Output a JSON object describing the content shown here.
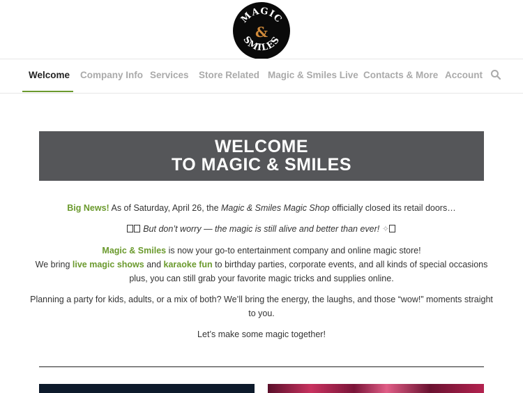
{
  "logo": {
    "line1": "MAGIC",
    "ampersand": "&",
    "line2": "SMILES"
  },
  "nav": {
    "items": [
      {
        "label": "Welcome",
        "active": true
      },
      {
        "label": "Company Info"
      },
      {
        "label": "Services"
      },
      {
        "label": "Store Related"
      },
      {
        "label": "Magic & Smiles Live"
      },
      {
        "label": "Contacts & More"
      },
      {
        "label": "Account"
      }
    ],
    "search_icon": "search-icon"
  },
  "banner": {
    "line1": "WELCOME",
    "line2": "TO MAGIC & SMILES"
  },
  "content": {
    "news_label": "Big News!",
    "news_text_a": " As of Saturday, April 26, the ",
    "news_shop": "Magic & Smiles Magic Shop",
    "news_text_b": " officially closed its retail doors…",
    "worry_text": " But don’t worry — the magic is still alive and better than ever! ",
    "brand": "Magic & Smiles",
    "brand_text": " is now your go-to entertainment company and online magic store!",
    "bring_a": "We bring ",
    "live_shows": "live magic shows",
    "bring_and": " and ",
    "karaoke": "karaoke fun",
    "bring_b": " to birthday parties, corporate events, and all kinds of special occasions",
    "bring_c": "plus, you can still grab your favorite magic tricks and supplies online.",
    "planning_a": "Planning a party for kids, adults, or a mix of both? We’ll bring the energy, the laughs, and those “wow!” moments straight",
    "planning_b": "to you.",
    "closing": "Let’s make some magic together!"
  },
  "colors": {
    "accent_green": "#6b9a2e",
    "banner_bg": "#555659"
  }
}
